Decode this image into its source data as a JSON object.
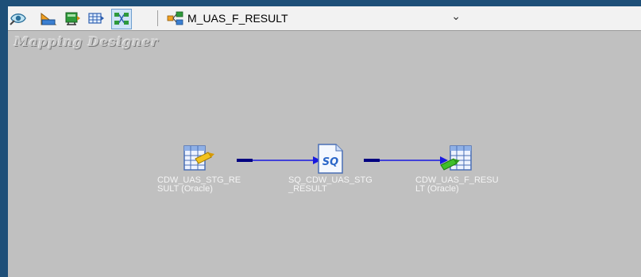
{
  "toolbar": {
    "buttons": [
      {
        "name": "source-analyzer",
        "icon": "source-analyzer-icon"
      },
      {
        "name": "target-designer",
        "icon": "target-designer-icon"
      },
      {
        "name": "transformation-developer",
        "icon": "transformation-developer-icon"
      },
      {
        "name": "mapplet-designer",
        "icon": "mapplet-designer-icon"
      },
      {
        "name": "mapping-designer",
        "icon": "mapping-designer-icon"
      }
    ],
    "mapping_select": {
      "value": "M_UAS_F_RESULT",
      "icon": "mapping-icon"
    }
  },
  "canvas": {
    "title": "Mapping Designer",
    "nodes": [
      {
        "label": "CDW_UAS_STG_RESULT (Oracle)",
        "icon": "source-table-icon",
        "type": "source"
      },
      {
        "label": "SQ_CDW_UAS_STG_RESULT",
        "icon": "source-qualifier-icon",
        "type": "source-qualifier",
        "badge": "SQ"
      },
      {
        "label": "CDW_UAS_F_RESULT (Oracle)",
        "icon": "target-table-icon",
        "type": "target"
      }
    ]
  },
  "colors": {
    "link": "#1818e0",
    "canvas": "#c0c0c0",
    "outer_background": "#1e4f78"
  }
}
